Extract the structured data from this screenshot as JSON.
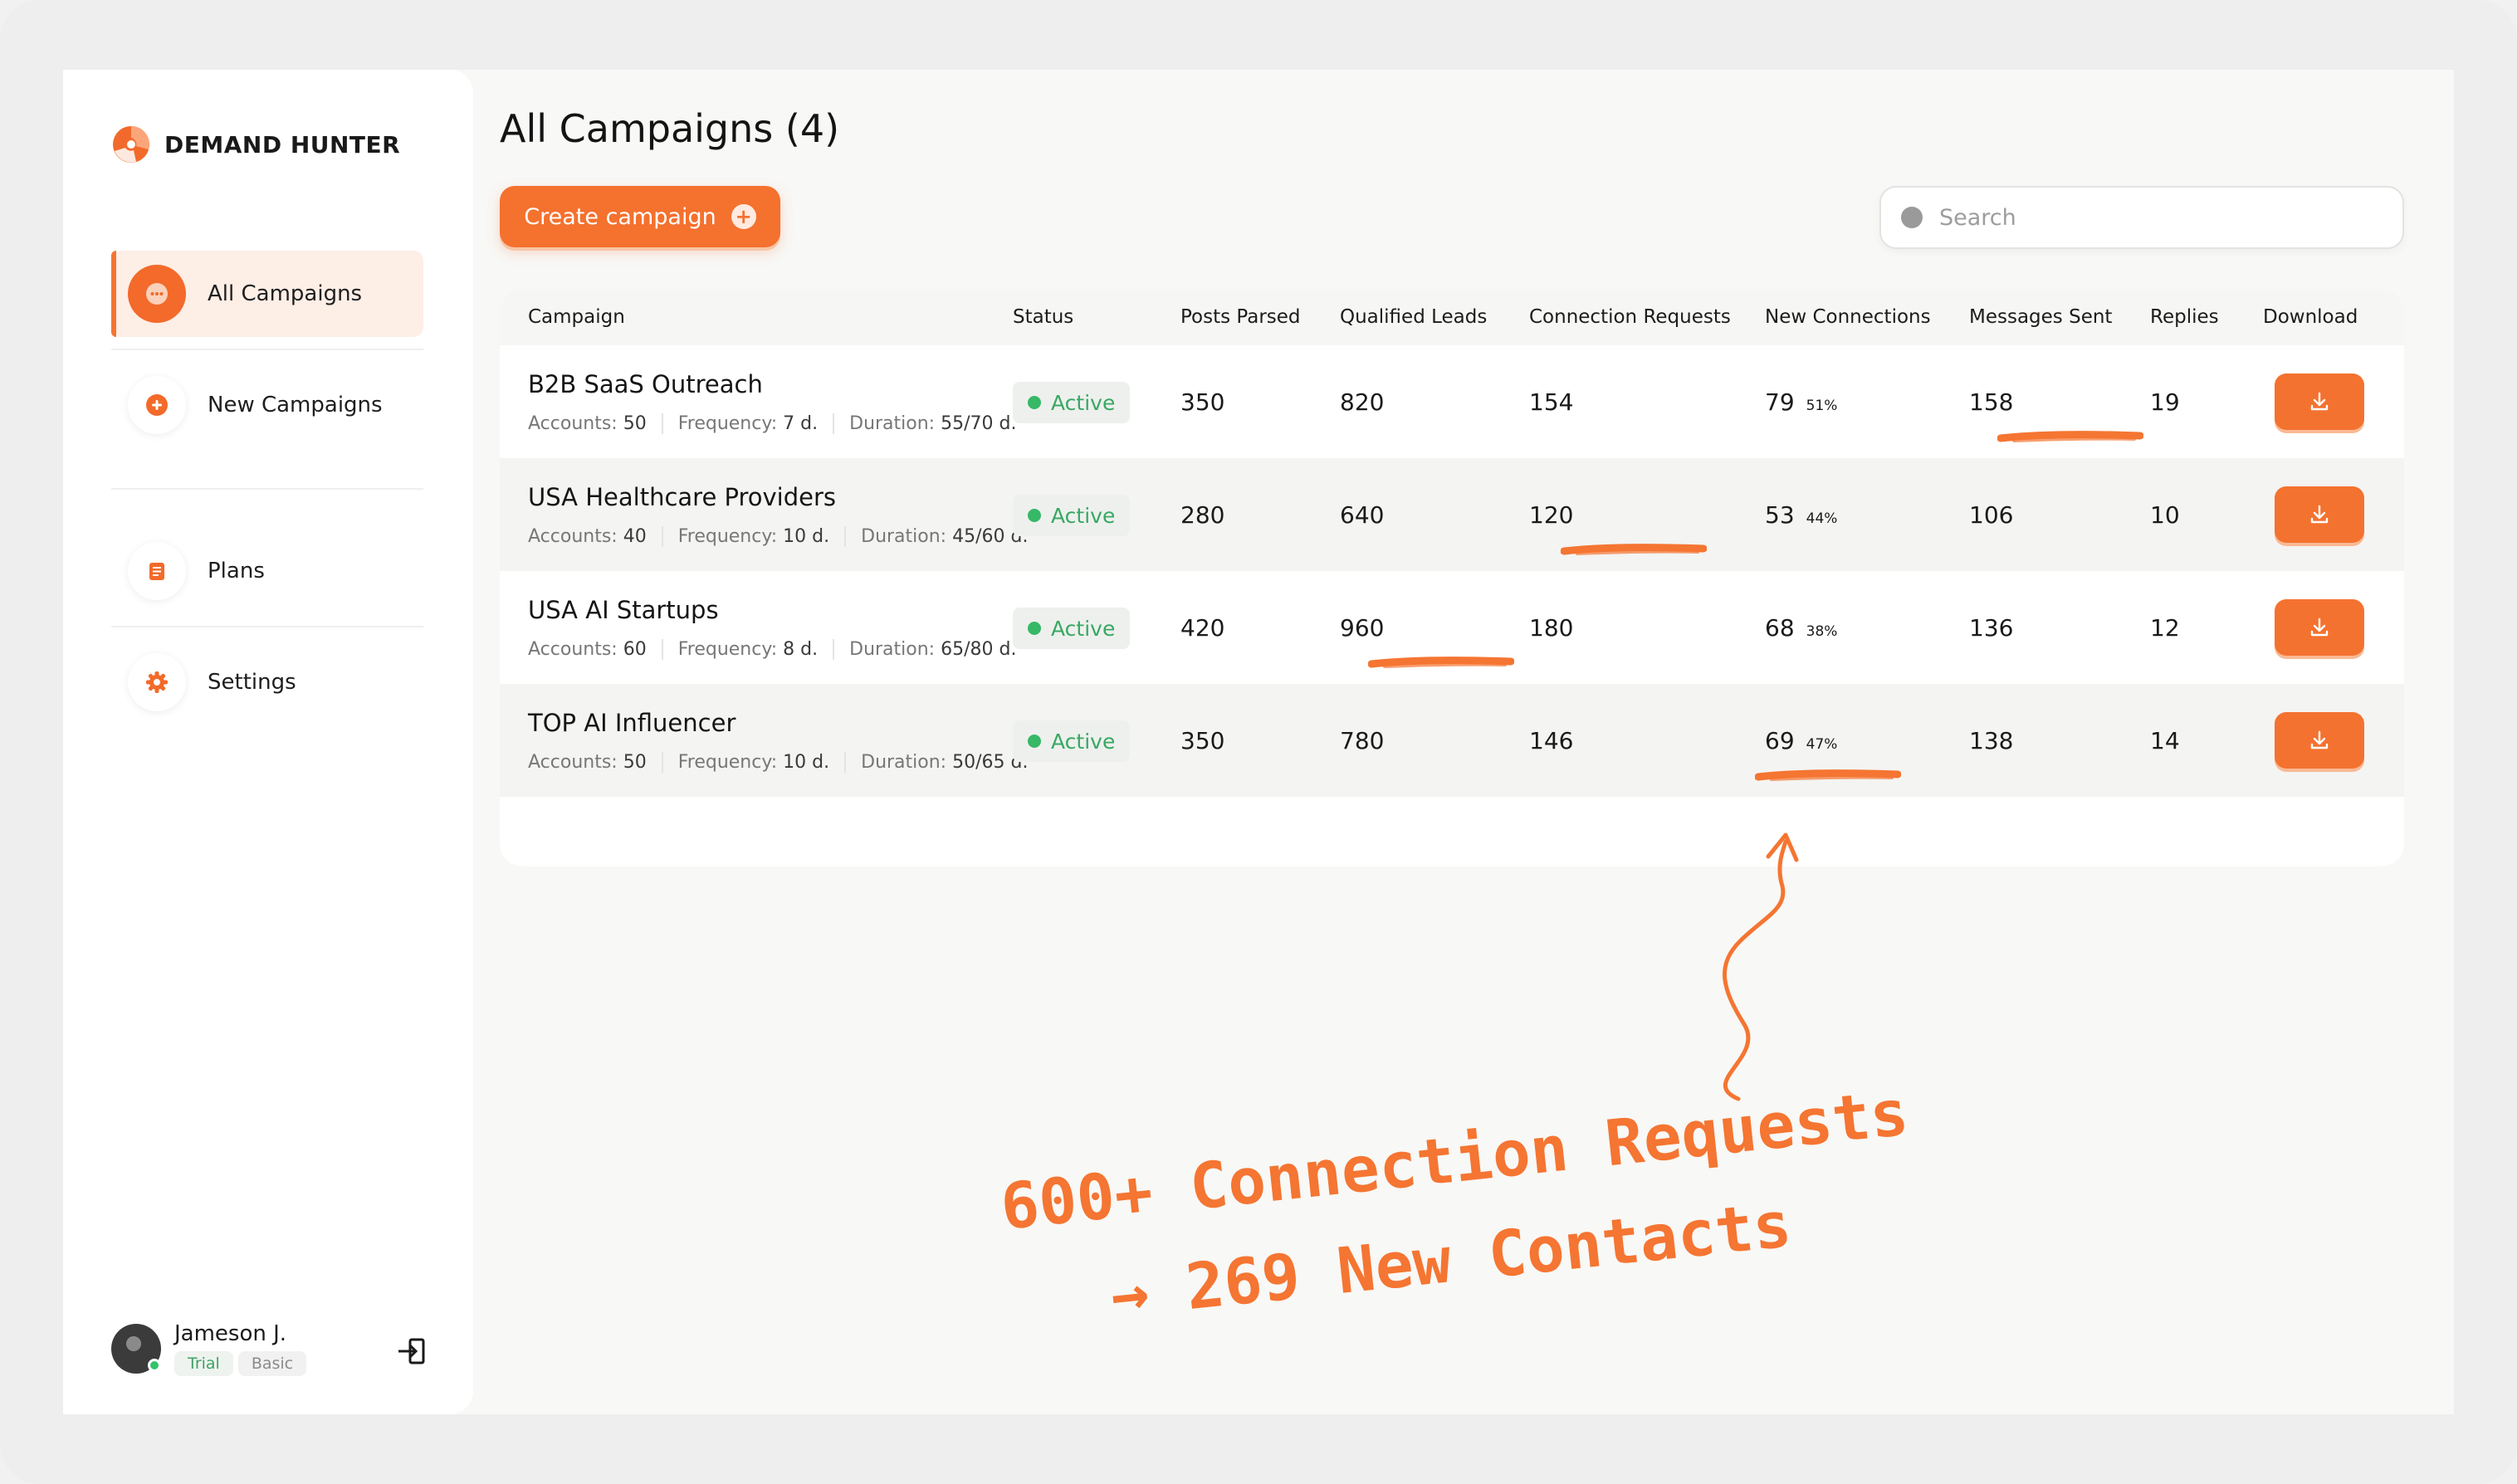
{
  "brand": {
    "name": "DEMAND HUNTER",
    "accent": "#f4712e"
  },
  "sidebar": {
    "items": [
      {
        "label": "All Campaigns",
        "icon": "dots-circle-icon",
        "active": true
      },
      {
        "label": "New Campaigns",
        "icon": "plus-circle-icon",
        "active": false
      },
      {
        "label": "Plans",
        "icon": "clipboard-icon",
        "active": false
      },
      {
        "label": "Settings",
        "icon": "gear-icon",
        "active": false
      }
    ]
  },
  "user": {
    "name": "Jameson J.",
    "badges": [
      "Trial",
      "Basic"
    ]
  },
  "header": {
    "title": "All Campaigns (4)",
    "create_label": "Create campaign"
  },
  "search": {
    "placeholder": "Search",
    "value": ""
  },
  "table": {
    "columns": [
      "Campaign",
      "Status",
      "Posts Parsed",
      "Qualified Leads",
      "Connection Requests",
      "New Connections",
      "Messages Sent",
      "Replies",
      "Download"
    ],
    "meta_labels": {
      "accounts": "Accounts:",
      "frequency": "Frequency:",
      "duration": "Duration:"
    },
    "rows": [
      {
        "name": "B2B SaaS Outreach",
        "accounts": "50",
        "frequency": "7 d.",
        "duration": "55/70 d.",
        "status": "Active",
        "posts_parsed": "350",
        "qualified_leads": "820",
        "connection_requests": "154",
        "new_connections": "79",
        "new_connections_pct": "51%",
        "messages_sent": "158",
        "replies": "19"
      },
      {
        "name": "USA Healthcare Providers",
        "accounts": "40",
        "frequency": "10 d.",
        "duration": "45/60 d.",
        "status": "Active",
        "posts_parsed": "280",
        "qualified_leads": "640",
        "connection_requests": "120",
        "new_connections": "53",
        "new_connections_pct": "44%",
        "messages_sent": "106",
        "replies": "10"
      },
      {
        "name": "USA AI Startups",
        "accounts": "60",
        "frequency": "8 d.",
        "duration": "65/80 d.",
        "status": "Active",
        "posts_parsed": "420",
        "qualified_leads": "960",
        "connection_requests": "180",
        "new_connections": "68",
        "new_connections_pct": "38%",
        "messages_sent": "136",
        "replies": "12"
      },
      {
        "name": "TOP AI Influencer",
        "accounts": "50",
        "frequency": "10 d.",
        "duration": "50/65 d.",
        "status": "Active",
        "posts_parsed": "350",
        "qualified_leads": "780",
        "connection_requests": "146",
        "new_connections": "69",
        "new_connections_pct": "47%",
        "messages_sent": "138",
        "replies": "14"
      }
    ]
  },
  "annotation": {
    "line1": "600+ Connection Requests",
    "line2": "→ 269 New Contacts",
    "color": "#f57532"
  }
}
